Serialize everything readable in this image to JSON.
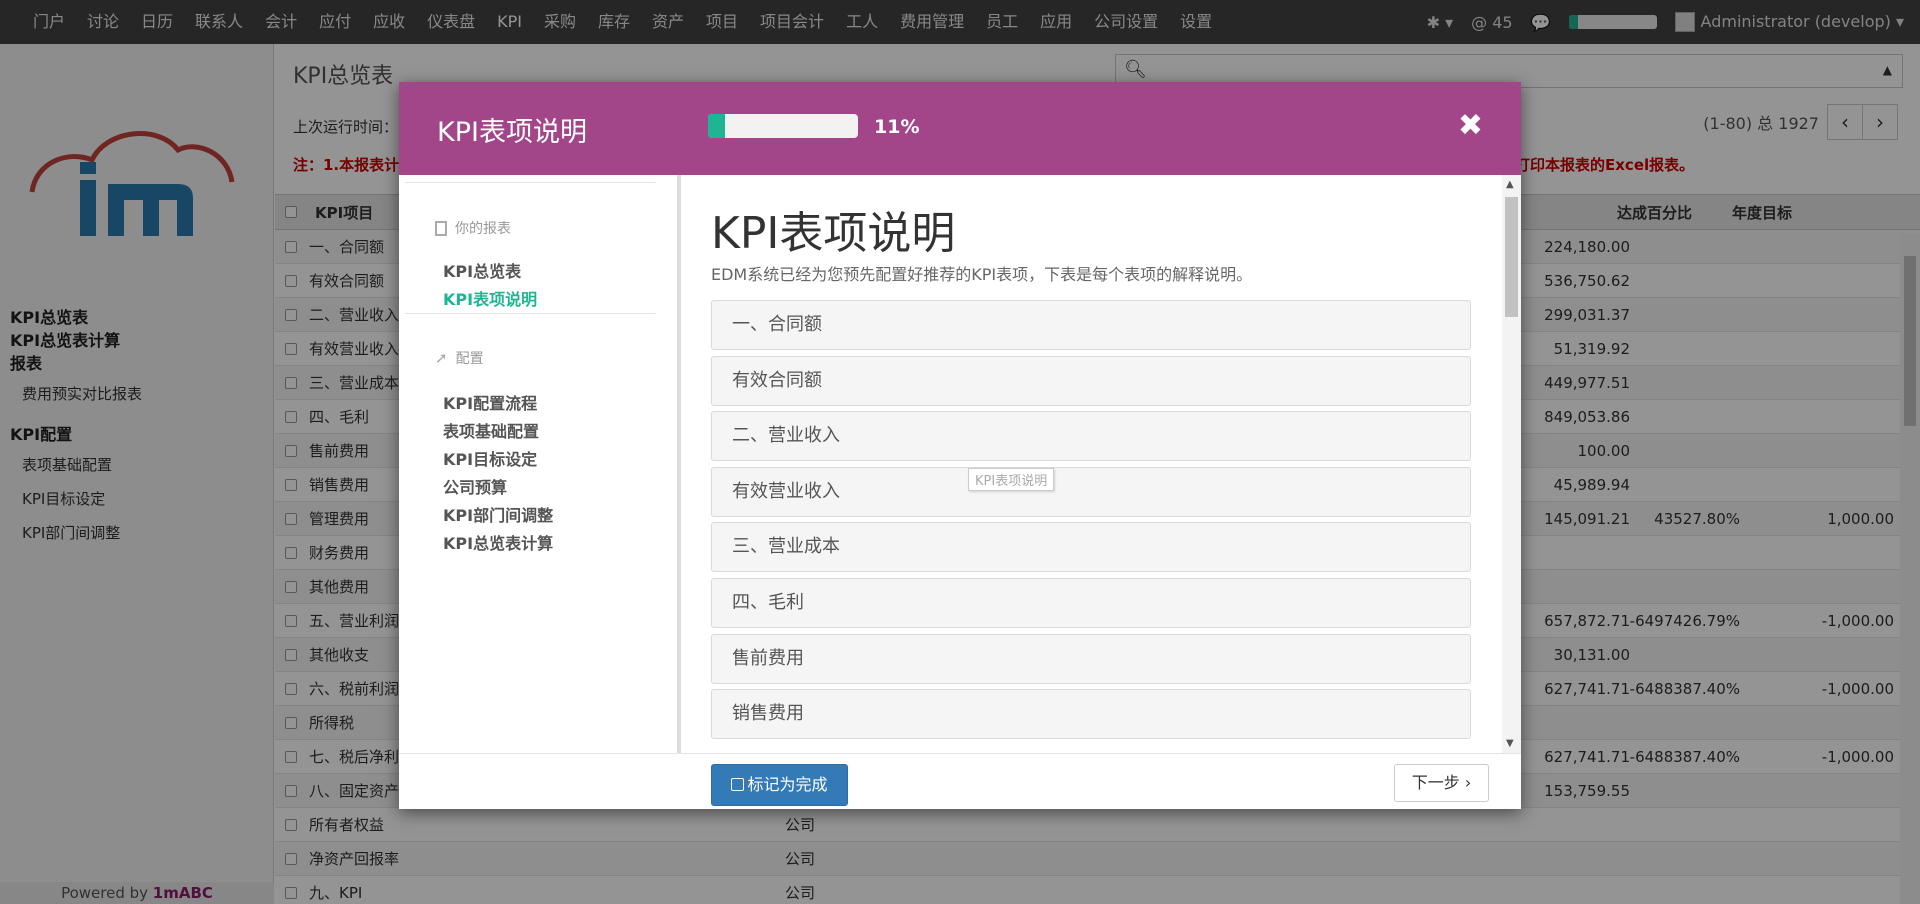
{
  "topbar": {
    "menu": [
      "门户",
      "讨论",
      "日历",
      "联系人",
      "会计",
      "应付",
      "应收",
      "仪表盘",
      "KPI",
      "采购",
      "库存",
      "资产",
      "项目",
      "项目会计",
      "工人",
      "费用管理",
      "员工",
      "应用",
      "公司设置",
      "设置"
    ],
    "active_index": 8,
    "mentions": "@ 45",
    "user": "Administrator (develop)",
    "progress": 0.11
  },
  "sidebar": {
    "items": [
      "KPI总览表",
      "KPI总览表计算",
      "报表"
    ],
    "sub1": [
      "费用预实对比报表"
    ],
    "section2": "KPI配置",
    "sub2": [
      "表项基础配置",
      "KPI目标设定",
      "KPI部门间调整"
    ],
    "powered_prefix": "Powered by ",
    "powered_brand": "1mABC"
  },
  "main": {
    "title": "KPI总览表",
    "last_run": "上次运行时间：",
    "pager": "(1-80) 总 1927",
    "note": "注：1.本报表计",
    "note_right": "打印本报表的Excel报表。",
    "headers": [
      "KPI项目",
      "达成百分比",
      "年度目标"
    ],
    "rows": [
      {
        "name": "一、合同额",
        "val": "224,180.00",
        "pct": "",
        "goal": ""
      },
      {
        "name": "有效合同额",
        "val": "536,750.62",
        "pct": "",
        "goal": ""
      },
      {
        "name": "二、营业收入",
        "val": "299,031.37",
        "pct": "",
        "goal": ""
      },
      {
        "name": "有效营业收入",
        "val": "51,319.92",
        "pct": "",
        "goal": ""
      },
      {
        "name": "三、营业成本",
        "val": "449,977.51",
        "pct": "",
        "goal": ""
      },
      {
        "name": "四、毛利",
        "val": "849,053.86",
        "pct": "",
        "goal": ""
      },
      {
        "name": "售前费用",
        "val": "100.00",
        "pct": "",
        "goal": ""
      },
      {
        "name": "销售费用",
        "val": "45,989.94",
        "pct": "",
        "goal": ""
      },
      {
        "name": "管理费用",
        "val": "145,091.21",
        "pct": "43527.80%",
        "goal": "1,000.00"
      },
      {
        "name": "财务费用",
        "val": "",
        "pct": "",
        "goal": ""
      },
      {
        "name": "其他费用",
        "val": "",
        "pct": "",
        "goal": ""
      },
      {
        "name": "五、营业利润",
        "val": "657,872.71",
        "pct": "-6497426.79%",
        "goal": "-1,000.00"
      },
      {
        "name": "其他收支",
        "val": "30,131.00",
        "pct": "",
        "goal": ""
      },
      {
        "name": "六、税前利润",
        "val": "627,741.71",
        "pct": "-6488387.40%",
        "goal": "-1,000.00"
      },
      {
        "name": "所得税",
        "val": "",
        "pct": "",
        "goal": ""
      },
      {
        "name": "七、税后净利",
        "val": "627,741.71",
        "pct": "-6488387.40%",
        "goal": "-1,000.00"
      },
      {
        "name": "八、固定资产",
        "val": "153,759.55",
        "pct": "",
        "goal": ""
      },
      {
        "name": "所有者权益",
        "company": "公司",
        "val": "",
        "pct": "",
        "goal": ""
      },
      {
        "name": "净资产回报率",
        "company": "公司",
        "val": "",
        "pct": "",
        "goal": ""
      },
      {
        "name": "九、KPI",
        "company": "公司",
        "val": "",
        "pct": "",
        "goal": ""
      }
    ]
  },
  "modal": {
    "title": "KPI表项说明",
    "progress_label": "11%",
    "progress": 0.11,
    "left": {
      "section1": "你的报表",
      "section1_items": [
        "KPI总览表",
        "KPI表项说明"
      ],
      "section2": "配置",
      "section2_items": [
        "KPI配置流程",
        "表项基础配置",
        "KPI目标设定",
        "公司预算",
        "KPI部门间调整",
        "KPI总览表计算"
      ]
    },
    "content_title": "KPI表项说明",
    "content_desc": "EDM系统已经为您预先配置好推荐的KPI表项，下表是每个表项的解释说明。",
    "panels": [
      "一、合同额",
      "有效合同额",
      "二、营业收入",
      "有效营业收入",
      "三、营业成本",
      "四、毛利",
      "售前费用",
      "销售费用"
    ],
    "tooltip": "KPI表项说明",
    "done_button": "标记为完成",
    "next_button": "下一步"
  }
}
